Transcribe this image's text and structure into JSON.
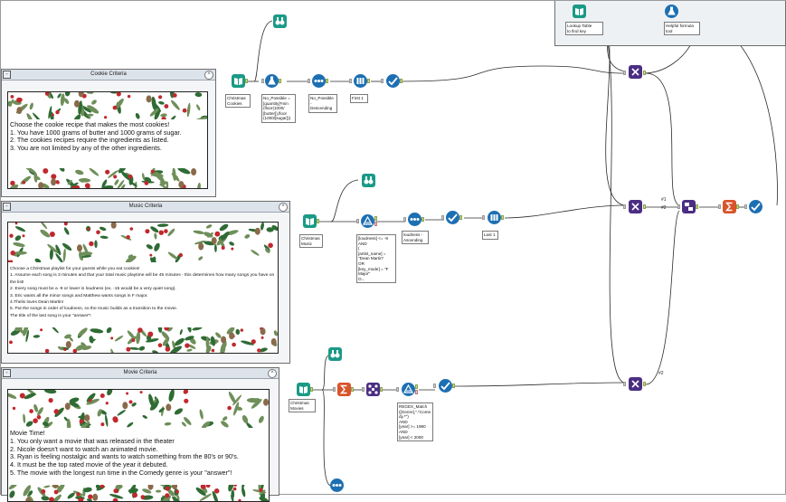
{
  "colors": {
    "tool_input": "#1a9a86",
    "tool_browse": "#1a9a86",
    "tool_prep": "#1d6fb3",
    "tool_join": "#4b2e83",
    "tool_summ": "#d9532b",
    "tool_formula": "#1d6fb3"
  },
  "containers": {
    "cookie": {
      "title": "Cookie Criteria",
      "text": "Choose the cookie recipe that makes the most cookies!\n1. You have 1000 grams of butter and 1000 grams of sugar.\n2. The cookies recipes require the ingredients as listed.\n3. You are not limited by any of the other ingredients."
    },
    "music": {
      "title": "Music Criteria",
      "text": "Choose a Christmas playlist for your guests while you eat cookies!\n1. Assume each song is 3 minutes and that your total music playtime will be 45 minutes - this determines how many songs you have on the list!\n2. Every song must be a -9 or lower in loudness (ex. -15 would be a very quiet song).\n3. Eric wants all the minor songs and Matthew wants songs in F major.\n4.Thelis loves Dean Martin!\n5. Put the songs in order of loudness, so the music builds as a transition to the movie.\nThe title of the last song is your \"answer\"!"
    },
    "movie": {
      "title": "Movie Criteria",
      "text": "Movie Time!\n1. You only want a movie that was released in the theater\n2. Nicole doesn't want to watch an animated movie.\n3. Ryan is feeling nostalgic and wants to watch something from the 80's or 90's.\n4. It must be the top rated movie of the year it debuted.\n5. The movie with the longest run time in the Comedy genre is your \"answer\"!"
    }
  },
  "labels": {
    "christmas_cookies": "Christmas\nCookies",
    "no_possible_formula": "No_Possible =\n[quantity]*min\n(floor(1000/\n[butter]),floor\n(1000/[sugar]))",
    "no_possible_desc": "No_Possible -\nDescending",
    "first1": "First 1",
    "christmas_music": "Christmas\nMusic",
    "music_filter": "[loudness] <= -9\nAND\n(\n[artist_name] =\n\"Dean Martin\"\nOR\n[key_mode] = \"F\nMajor\"\nO...",
    "loudness_asc": "loudness -\nAscending",
    "last1": "Last 1",
    "christmas_movies": "Christmas\nMovies",
    "movie_filter": "REGEX_Match\n([Genre],\".*Come\ndy.*\")\nAND\n[year] >= 1980\nAND\n[year] < 2000",
    "lookup_table": "Lookup Table\nto find key",
    "helpful_formula": "Helpful formula\ntool"
  },
  "connection_labels": {
    "c1": "#1",
    "c2": "#2",
    "c3": "#2"
  }
}
